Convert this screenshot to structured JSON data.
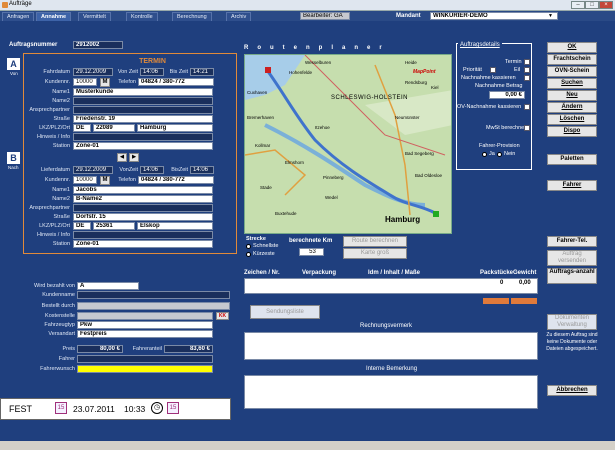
{
  "window": {
    "title": "Aufträge",
    "icon": "app-icon"
  },
  "tabs": [
    {
      "label": "Anfragen"
    },
    {
      "label": "Annahme"
    },
    {
      "label": "Vermittelt"
    },
    {
      "label": "Kontrolle"
    },
    {
      "label": "Berechnung"
    },
    {
      "label": "Archiv"
    }
  ],
  "header": {
    "bearbeiter": "Bearbeiter: GA",
    "mandant_label": "Mandant",
    "mandant_value": "WINKURIER-DEMO",
    "auftragsnummer_label": "Auftragsnummer",
    "auftragsnummer": "2912002"
  },
  "termin": {
    "title": "TERMIN"
  },
  "pickup": {
    "letter": "A",
    "sub": "Von",
    "fahrdatum_label": "Fahrdatum",
    "fahrdatum": "29.12.2009",
    "vonzeit_label": "Von Zeit",
    "vonzeit": "14:06",
    "biszeit_label": "Bis Zeit",
    "biszeit": "14:21",
    "kunden_label": "Kundennr.",
    "kunden": "10000",
    "m": "M",
    "telefon_label": "Telefon",
    "telefon": "04824 / 380-772",
    "name1_label": "Name1",
    "name1": "Musterkunde",
    "name2_label": "Name2",
    "name2": "",
    "ansprech_label": "Ansprechpartner",
    "ansprech": "",
    "strasse_label": "Straße",
    "strasse": "Friedenstr. 19",
    "lkz_label": "LKZ/PLZ/Ort",
    "lkz": "DE",
    "plz": "22089",
    "ort": "Hamburg",
    "hinweis_label": "Hinweis / Info",
    "hinweis": "",
    "station_label": "Station",
    "station": "Zone-01"
  },
  "delivery": {
    "letter": "B",
    "sub": "Nach",
    "lieferdatum_label": "Lieferdatum",
    "lieferdatum": "29.12.2009",
    "vonzeit_label": "VonZeit",
    "vonzeit": "14:06",
    "biszeit_label": "BisZeit",
    "biszeit": "14:06",
    "kunden_label": "Kundennr.",
    "kunden": "10000",
    "m": "M",
    "telefon_label": "Telefon",
    "telefon": "04824 / 380-772",
    "name1_label": "Name1",
    "name1": "Jacobs",
    "name2_label": "Name2",
    "name2": "B-Name2",
    "ansprech_label": "Ansprechpartner",
    "ansprech": "",
    "strasse_label": "Straße",
    "strasse": "Dorfstr. 15",
    "lkz_label": "LKZ/PLZ/Ort",
    "lkz": "DE",
    "plz": "25361",
    "ort": "Elskop",
    "hinweis_label": "Hinweis / Info",
    "hinweis": "",
    "station_label": "Station",
    "station": "Zone-01"
  },
  "payment": {
    "wird_label": "Wird bezahlt von",
    "wird": "A",
    "kundenname_label": "Kundenname",
    "kundenname": "",
    "bestellt_label": "Bestellt durch",
    "bestellt": "",
    "kostenstelle_label": "Kostenstelle",
    "kostenstelle": "",
    "kk": "KK",
    "fahrzeug_label": "Fahrzeugtyp",
    "fahrzeug": "Pkw",
    "versand_label": "Versandart",
    "versand": "Festpreis",
    "preis_label": "Preis",
    "preis": "80,00 €",
    "fahreranteil_label": "Fahreranteil",
    "fahreranteil": "83,60 €",
    "fahrer_label": "Fahrer",
    "fahrer": "",
    "fahrerwunsch_label": "Fahrerwunsch",
    "fahrerwunsch": ""
  },
  "map": {
    "heading": "Routenplaner",
    "strecke_label": "Strecke",
    "schnellste": "Schnellste",
    "kuerzeste": "Kürzeste",
    "km_label": "berechnete Km",
    "km": "53",
    "route_btn": "Route berechnen",
    "karte_btn": "Karte groß",
    "logo": "MapPoint",
    "places": [
      "Heide",
      "Wesselburen",
      "Hohenfelde",
      "Itzehoe",
      "Elmshorn",
      "Pinneberg",
      "Stade",
      "Buxtehude",
      "Hamburg",
      "Rendsburg",
      "Kiel",
      "Neumünster",
      "Bad Segeberg",
      "Bad Oldesloe",
      "Cuxhaven",
      "Bremerhaven",
      "Wedel",
      "SCHLESWIG-HOLSTEIN",
      "Kollmar"
    ]
  },
  "details": {
    "title": "Auftragsdetails",
    "termin": "Termin",
    "prioritaet": "Priorität",
    "eil": "Eil",
    "nachnahme_kass": "Nachnahme kassieren",
    "nachnahme_betrag_label": "Nachnahme Betrag",
    "nachnahme_betrag": "0,00 €",
    "ov_nachnahme": "OV-Nachnahme kassieren",
    "mwst": "MwSt berechnen",
    "provision_label": "Fahrer-Provision",
    "ja": "Ja",
    "nein": "Nein"
  },
  "goods": {
    "col_zeichen": "Zeichen / Nr.",
    "col_verpackung": "Verpackung",
    "col_idm": "Idm / Inhalt / Maße",
    "col_packstuecke": "Packstücke",
    "col_gewicht": "Gewicht",
    "packstuecke": "0",
    "gewicht": "0,00"
  },
  "sendungsliste": "Sendungsliste",
  "rechnungsvermerk": "Rechnungsvermerk",
  "interne_bemerkung": "Interne Bemerkung",
  "buttons": {
    "ok": "OK",
    "frachtschein": "Frachtschein",
    "ovn": "OVN-Schein",
    "suchen": "Suchen",
    "neu": "Neu",
    "andern": "Ändern",
    "loeschen": "Löschen",
    "dispo": "Dispo",
    "paletten": "Paletten",
    "fahrer": "Fahrer",
    "fahrer_tel": "Fahrer-Tel.",
    "auftrag_versenden": "Auftrag versenden",
    "auftragsanzahl": "Auftrags-anzahl",
    "dokumenten": "Dokumenten Verwaltung",
    "abbrechen": "Abbrechen"
  },
  "dokument_info": "Zu diesem Auftrag sind keine Dokumente oder Dateien abgespeichert.",
  "status": {
    "fest": "FEST",
    "date": "23.07.2011",
    "time": "10:33"
  },
  "colors": {
    "bg": "#1f3f7e",
    "accent": "#e08a3a",
    "price": "#1a2f5c"
  }
}
